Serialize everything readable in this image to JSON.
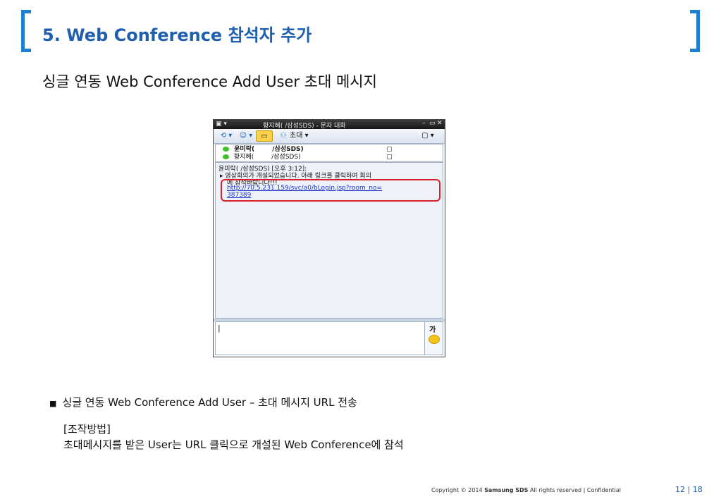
{
  "header": {
    "title": "5. Web Conference 참석자 추가",
    "subtitle": "싱글 연동 Web Conference Add User 초대 메시지",
    "accent_color": "#1e7fd0"
  },
  "window": {
    "title": "황지혜(       /삼성SDS) - 문자 대화",
    "toolbar": {
      "invite_label": "초대"
    },
    "participants": [
      {
        "name": "윤미락(",
        "org": "/삼성SDS)"
      },
      {
        "name": "황지혜(",
        "org": "/삼성SDS)"
      }
    ],
    "chat": {
      "sender_line": "윤미락(     /삼성SDS) [오후 3:12]:",
      "message_line1": "영상회의가 개설되었습니다. 아래 링크를 클릭하여 회의",
      "message_line2": "에 참석바랍니다!!!",
      "link_line1": "http://70.5.231.159/svc/a0/bLogin.jsp?room_no=",
      "link_line2": "387389"
    },
    "input": {
      "font_button": "가"
    }
  },
  "body": {
    "bullet": "싱글 연동  Web Conference Add User – 초대 메시지 URL 전송",
    "method_label": "[조작방법]",
    "method_text": "초대메시지를 받은 User는 URL 클릭으로 개설된 Web Conference에 참석"
  },
  "footer": {
    "copyright_prefix": "Copyright © 2014",
    "company": "Samsung SDS",
    "copyright_suffix": "All rights reserved   |  Confidential",
    "page": "12 | 18"
  },
  "icons": [
    "messenger-app-icon",
    "refresh-icon",
    "add-user-icon",
    "chat-bubble-icon",
    "invite-group-icon",
    "note-icon",
    "online-status-icon",
    "emoticon-icon"
  ]
}
